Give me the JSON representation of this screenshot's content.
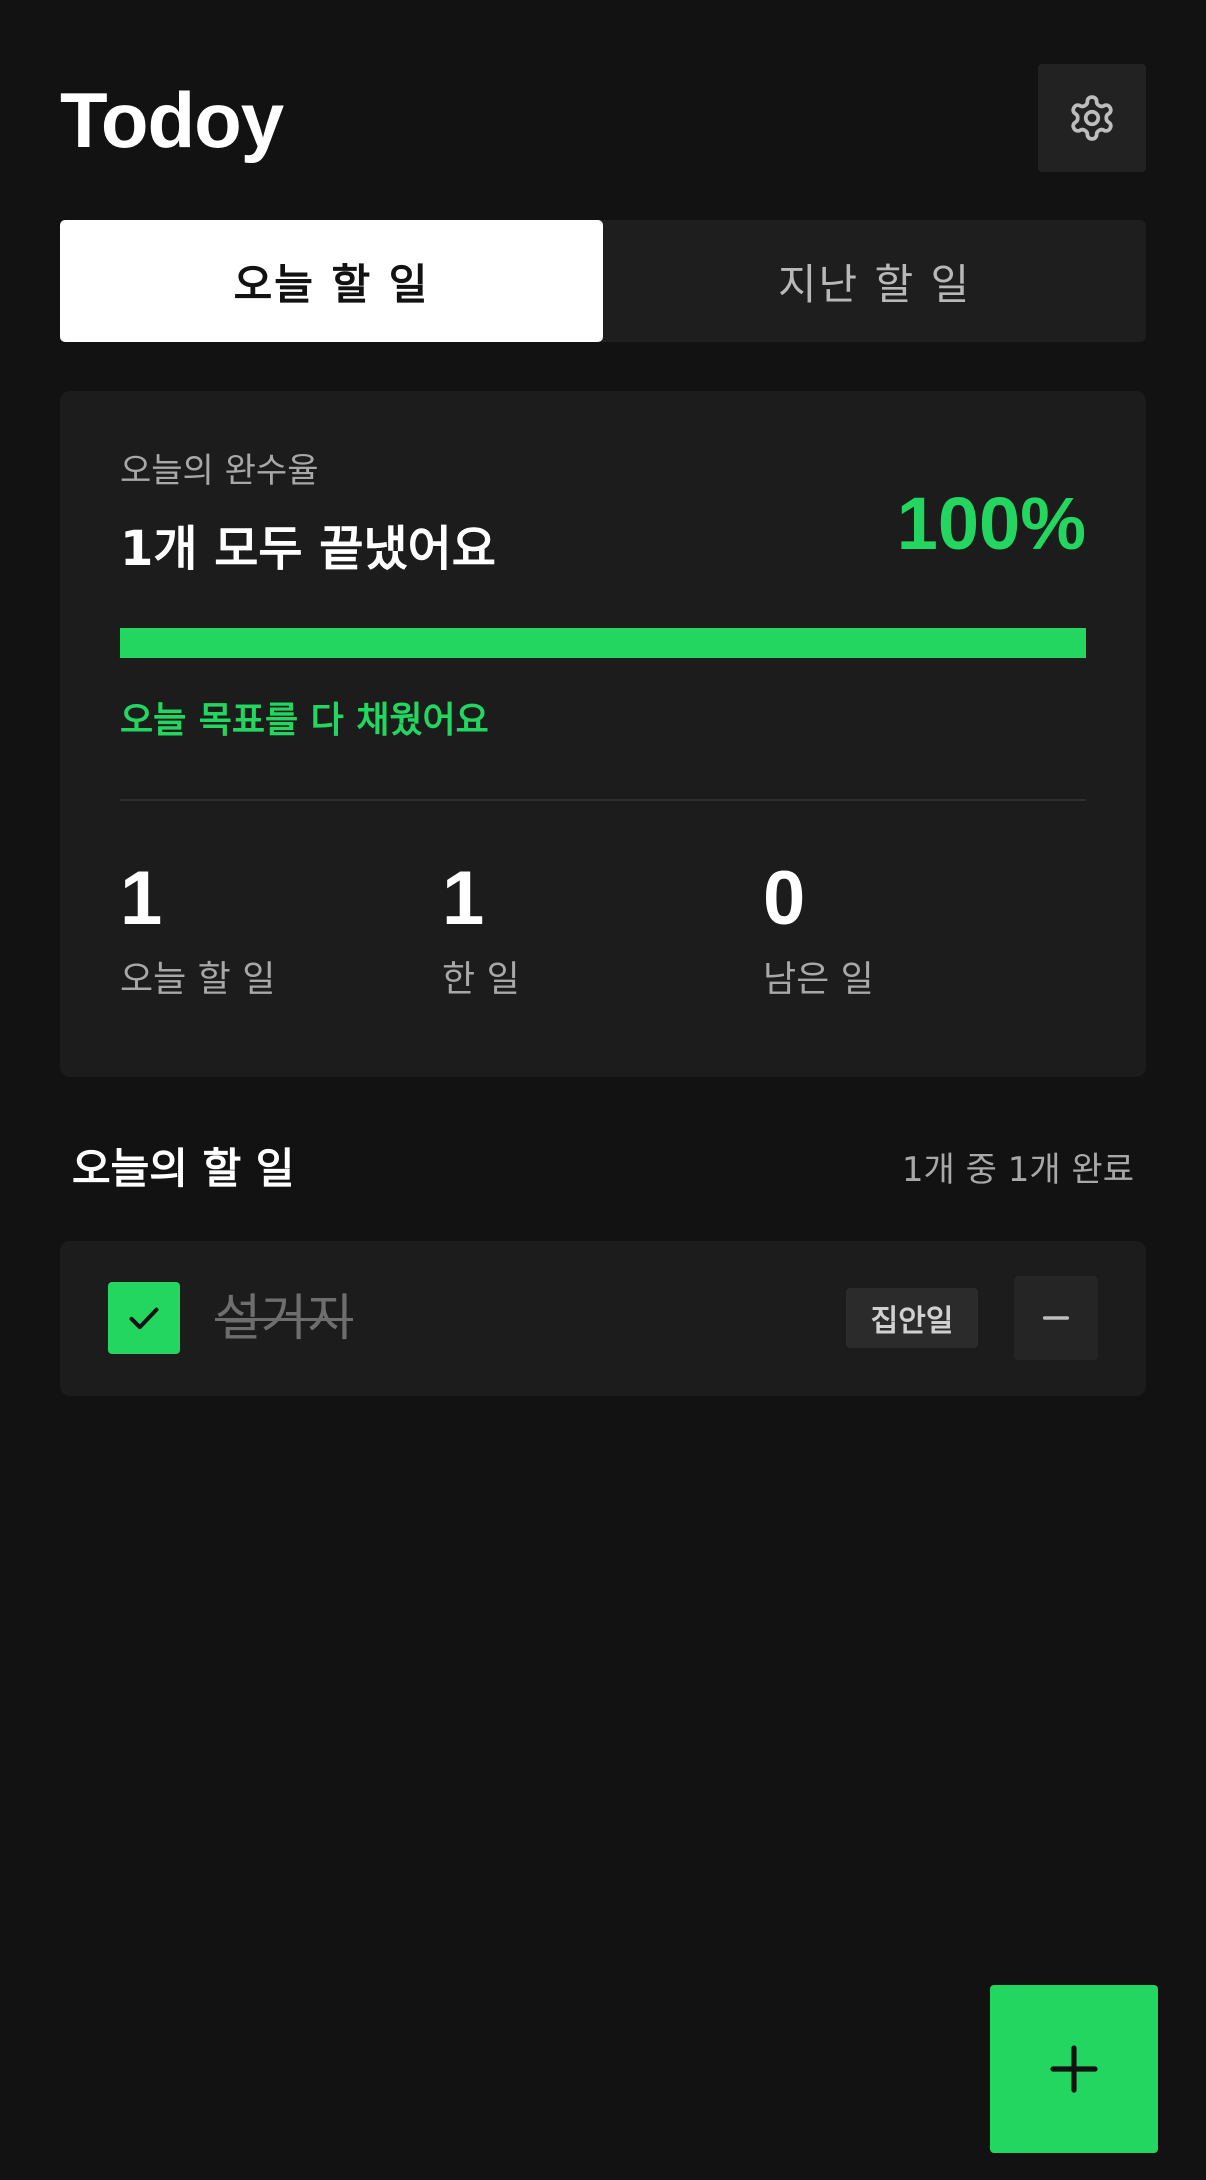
{
  "app": {
    "title": "Todoy",
    "accent_color": "#22d660"
  },
  "header": {
    "settings_icon": "gear-icon"
  },
  "tabs": [
    {
      "label": "오늘 할 일",
      "active": true
    },
    {
      "label": "지난 할 일",
      "active": false
    }
  ],
  "summary": {
    "label": "오늘의 완수율",
    "headline": "1개 모두 끝냈어요",
    "percent_text": "100%",
    "progress_fraction": 1.0,
    "goal_message": "오늘 목표를 다 채웠어요",
    "stats": [
      {
        "value": "1",
        "label": "오늘 할 일"
      },
      {
        "value": "1",
        "label": "한 일"
      },
      {
        "value": "0",
        "label": "남은 일"
      }
    ]
  },
  "todo_section": {
    "title": "오늘의 할 일",
    "count_text": "1개 중 1개 완료"
  },
  "todos": [
    {
      "text": "설거지",
      "category": "집안일",
      "completed": true,
      "check_icon": "check-icon",
      "delete_icon": "minus-icon"
    }
  ],
  "fab": {
    "icon": "plus-icon"
  }
}
